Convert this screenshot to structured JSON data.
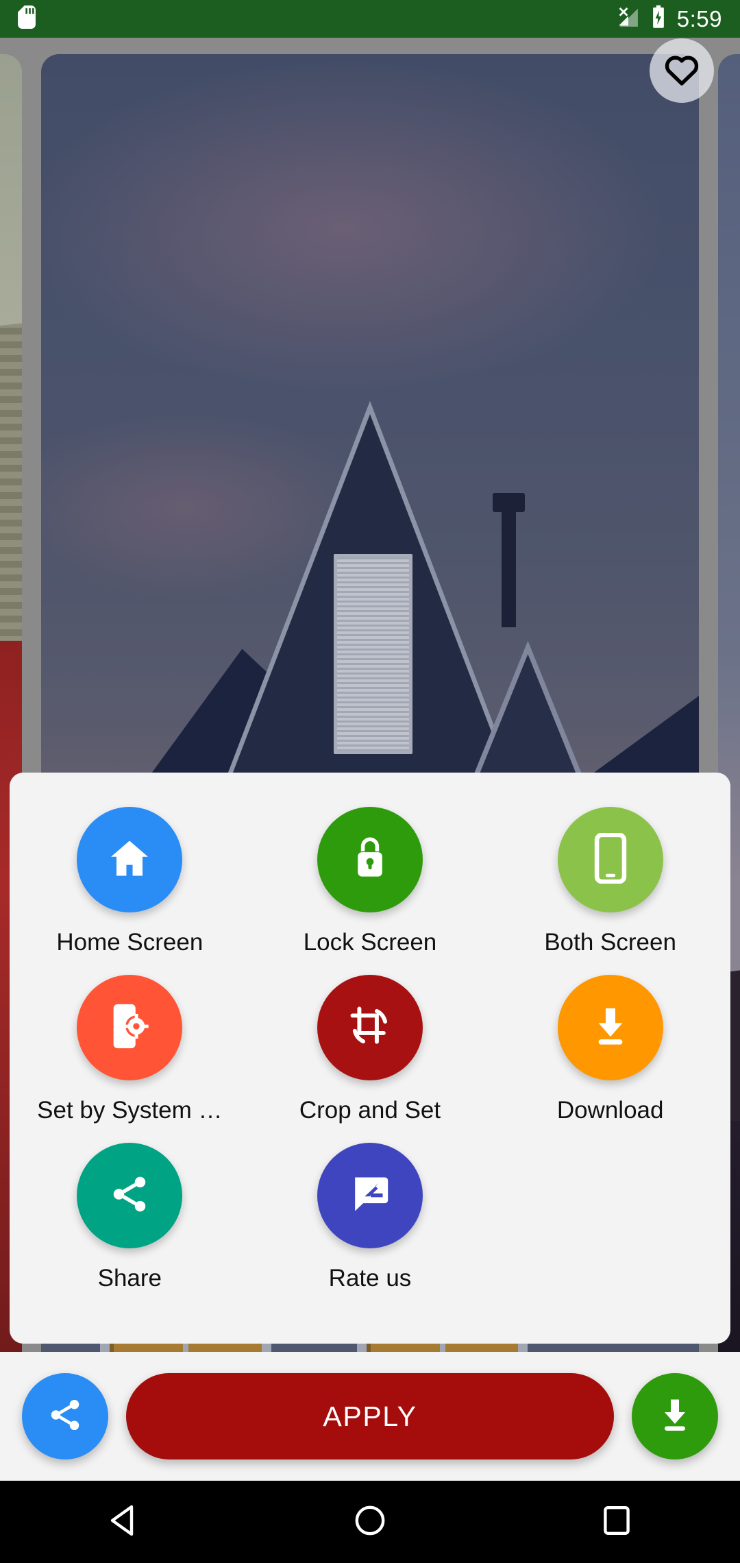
{
  "status_bar": {
    "background_color": "#1B5E20",
    "time": "5:59",
    "icons": [
      "sd-card-icon",
      "signal-no-sim-icon",
      "battery-charging-icon"
    ]
  },
  "wallpaper": {
    "description": "House with gabled roofs at dusk",
    "favorite_icon": "heart-outline-icon",
    "favorite_active": false,
    "cards": [
      {
        "name": "previous-wallpaper",
        "style": "red"
      },
      {
        "name": "current-wallpaper",
        "style": "house"
      },
      {
        "name": "next-wallpaper",
        "style": "dark"
      }
    ]
  },
  "sheet": {
    "background_color": "#F3F3F3",
    "options": [
      {
        "label": "Home Screen",
        "icon": "home-icon",
        "color": "#2A8CF5"
      },
      {
        "label": "Lock Screen",
        "icon": "lock-icon",
        "color": "#2E9B0C"
      },
      {
        "label": "Both Screen",
        "icon": "smartphone-icon",
        "color": "#8BC34A"
      },
      {
        "label": "Set by System …",
        "icon": "phone-settings-icon",
        "color": "#FF5436"
      },
      {
        "label": "Crop and Set",
        "icon": "crop-rotate-icon",
        "color": "#A81111"
      },
      {
        "label": "Download",
        "icon": "download-icon",
        "color": "#FF9800"
      },
      {
        "label": "Share",
        "icon": "share-icon",
        "color": "#00A383"
      },
      {
        "label": "Rate us",
        "icon": "rate-review-icon",
        "color": "#3F45BE"
      }
    ]
  },
  "action_bar": {
    "share_icon": "share-icon",
    "share_color": "#2A8CF5",
    "apply_label": "APPLY",
    "apply_color": "#A50D0D",
    "download_icon": "download-icon",
    "download_color": "#2E9B0C"
  },
  "nav_bar": {
    "background_color": "#000000",
    "buttons": [
      {
        "name": "back-button",
        "icon": "triangle-back-icon"
      },
      {
        "name": "home-button",
        "icon": "circle-home-icon"
      },
      {
        "name": "recents-button",
        "icon": "square-recents-icon"
      }
    ]
  }
}
